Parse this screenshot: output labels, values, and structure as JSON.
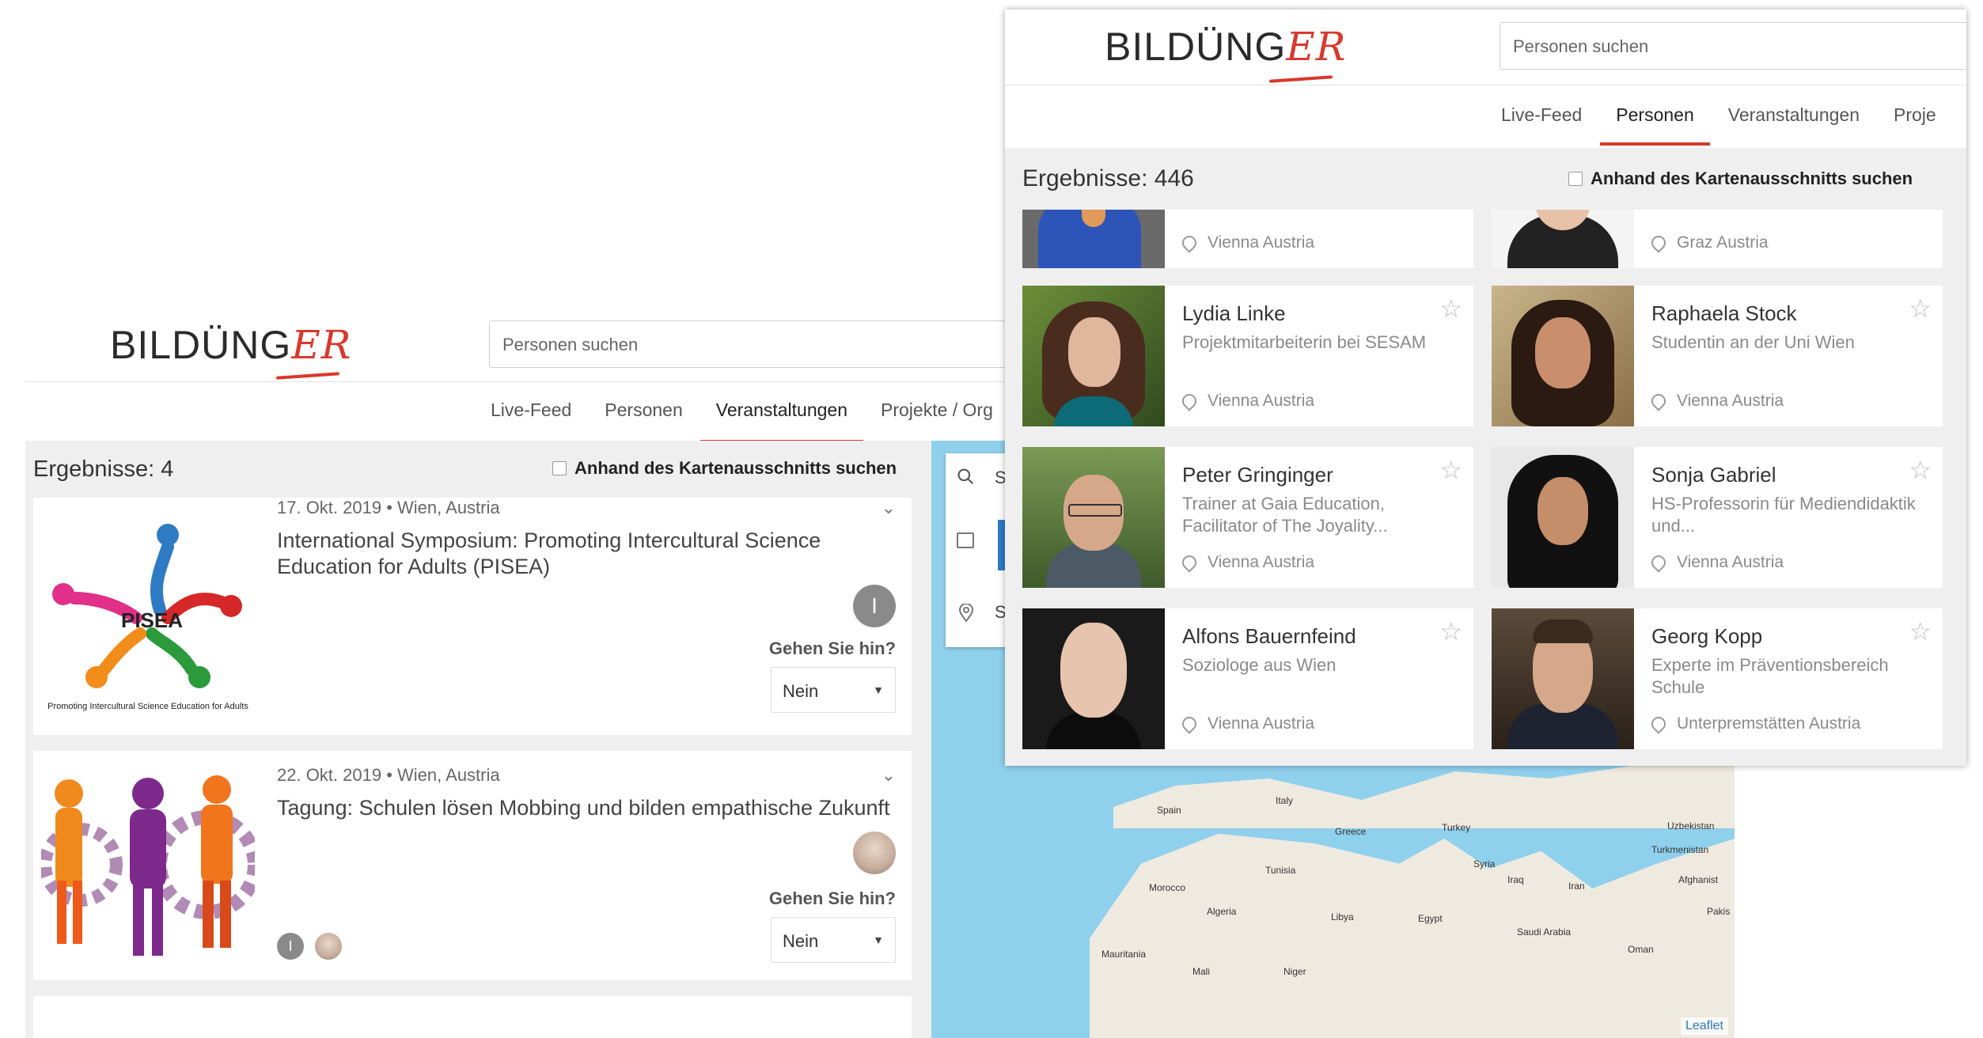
{
  "back_window": {
    "logo_text": "BILDÜNG",
    "logo_accent": "ER",
    "search": {
      "placeholder": "Personen suchen"
    },
    "nav": [
      "Live-Feed",
      "Personen",
      "Veranstaltungen",
      "Projekte / Org"
    ],
    "active_tab": "Veranstaltungen",
    "results_label": "Ergebnisse: 4",
    "map_filter_label": "Anhand des Kartenausschnitts suchen",
    "events": [
      {
        "date_place": "17. Okt. 2019  •  Wien, Austria",
        "title": "International Symposium: Promoting Intercultural Science Education for Adults (PISEA)",
        "logo_text": "PISEA",
        "logo_caption": "Promoting Intercultural Science Education for Adults",
        "avatar_initial": "I",
        "question": "Gehen Sie hin?",
        "answer": "Nein"
      },
      {
        "date_place": "22. Okt. 2019  •  Wien, Austria",
        "title": "Tagung: Schulen lösen Mobbing und bilden empathische Zukunft",
        "avatar_initial": "I",
        "question": "Gehen Sie hin?",
        "answer": "Nein"
      }
    ],
    "map": {
      "search_letter_1": "S",
      "search_letter_2": "S",
      "labels": [
        "Spain",
        "Italy",
        "Greece",
        "Turkey",
        "Syria",
        "Iraq",
        "Iran",
        "Tunisia",
        "Morocco",
        "Algeria",
        "Libya",
        "Egypt",
        "Saudi Arabia",
        "Oman",
        "Uzbekistan",
        "Turkmenistan",
        "Afghanist",
        "Mauritania",
        "Mali",
        "Niger",
        "Pakis"
      ],
      "attribution": "Leaflet"
    }
  },
  "front_window": {
    "logo_text": "BILDÜNG",
    "logo_accent": "ER",
    "search": {
      "placeholder": "Personen suchen"
    },
    "nav": [
      "Live-Feed",
      "Personen",
      "Veranstaltungen",
      "Proje"
    ],
    "active_tab": "Personen",
    "results_label": "Ergebnisse: 446",
    "map_filter_label": "Anhand des Kartenausschnitts suchen",
    "partial_row": [
      {
        "location": "Vienna Austria"
      },
      {
        "location": "Graz Austria"
      }
    ],
    "people": [
      {
        "name": "Lydia Linke",
        "title": "Projektmitarbeiterin bei SESAM",
        "location": "Vienna Austria"
      },
      {
        "name": "Raphaela Stock",
        "title": "Studentin an der Uni Wien",
        "location": "Vienna Austria"
      },
      {
        "name": "Peter Gringinger",
        "title": "Trainer at Gaia Education, Facilitator of The Joyality...",
        "location": "Vienna Austria"
      },
      {
        "name": "Sonja Gabriel",
        "title": "HS-Professorin für Mediendidaktik und...",
        "location": "Vienna Austria"
      },
      {
        "name": "Alfons Bauernfeind",
        "title": "Soziologe aus Wien",
        "location": "Vienna Austria"
      },
      {
        "name": "Georg Kopp",
        "title": "Experte im Präventionsbereich Schule",
        "location": "Unterpremstätten Austria"
      }
    ]
  },
  "colors": {
    "accent": "#d9382c",
    "map_water": "#8fd0ec",
    "map_land": "#efeae0"
  }
}
